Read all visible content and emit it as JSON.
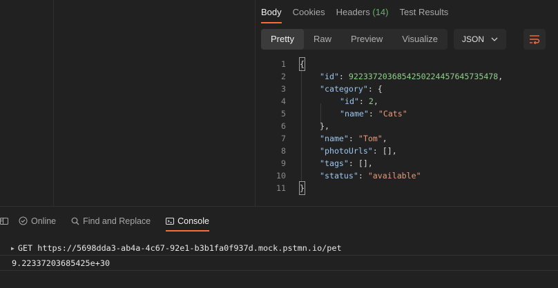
{
  "response_tabs": [
    {
      "label": "Body",
      "active": true
    },
    {
      "label": "Cookies"
    },
    {
      "label": "Headers",
      "count": "(14)"
    },
    {
      "label": "Test Results"
    }
  ],
  "view_modes": [
    "Pretty",
    "Raw",
    "Preview",
    "Visualize"
  ],
  "format_select": "JSON",
  "code_lines": [
    {
      "n": "1"
    },
    {
      "n": "2"
    },
    {
      "n": "3"
    },
    {
      "n": "4"
    },
    {
      "n": "5"
    },
    {
      "n": "6"
    },
    {
      "n": "7"
    },
    {
      "n": "8"
    },
    {
      "n": "9"
    },
    {
      "n": "10"
    },
    {
      "n": "11"
    }
  ],
  "json": {
    "open_brace": "{",
    "close_brace": "}",
    "id_key": "\"id\"",
    "id_value": "9223372036854250224457645735478",
    "category_key": "\"category\"",
    "cat_id_key": "\"id\"",
    "cat_id_value": "2",
    "cat_name_key": "\"name\"",
    "cat_name_value": "\"Cats\"",
    "name_key": "\"name\"",
    "name_value": "\"Tom\"",
    "photo_key": "\"photoUrls\"",
    "tags_key": "\"tags\"",
    "status_key": "\"status\"",
    "status_value": "\"available\""
  },
  "statusbar": {
    "online": "Online",
    "find_replace": "Find and Replace",
    "console": "Console"
  },
  "console": {
    "request": "GET https://5698dda3-ab4a-4c67-92e1-b3b1fa0f937d.mock.pstmn.io/pet",
    "output": "9.22337203685425e+30"
  },
  "colors": {
    "accent": "#ff6c37",
    "key": "#9cc6f0",
    "number": "#8fcf8a",
    "string": "#e79a7b"
  }
}
